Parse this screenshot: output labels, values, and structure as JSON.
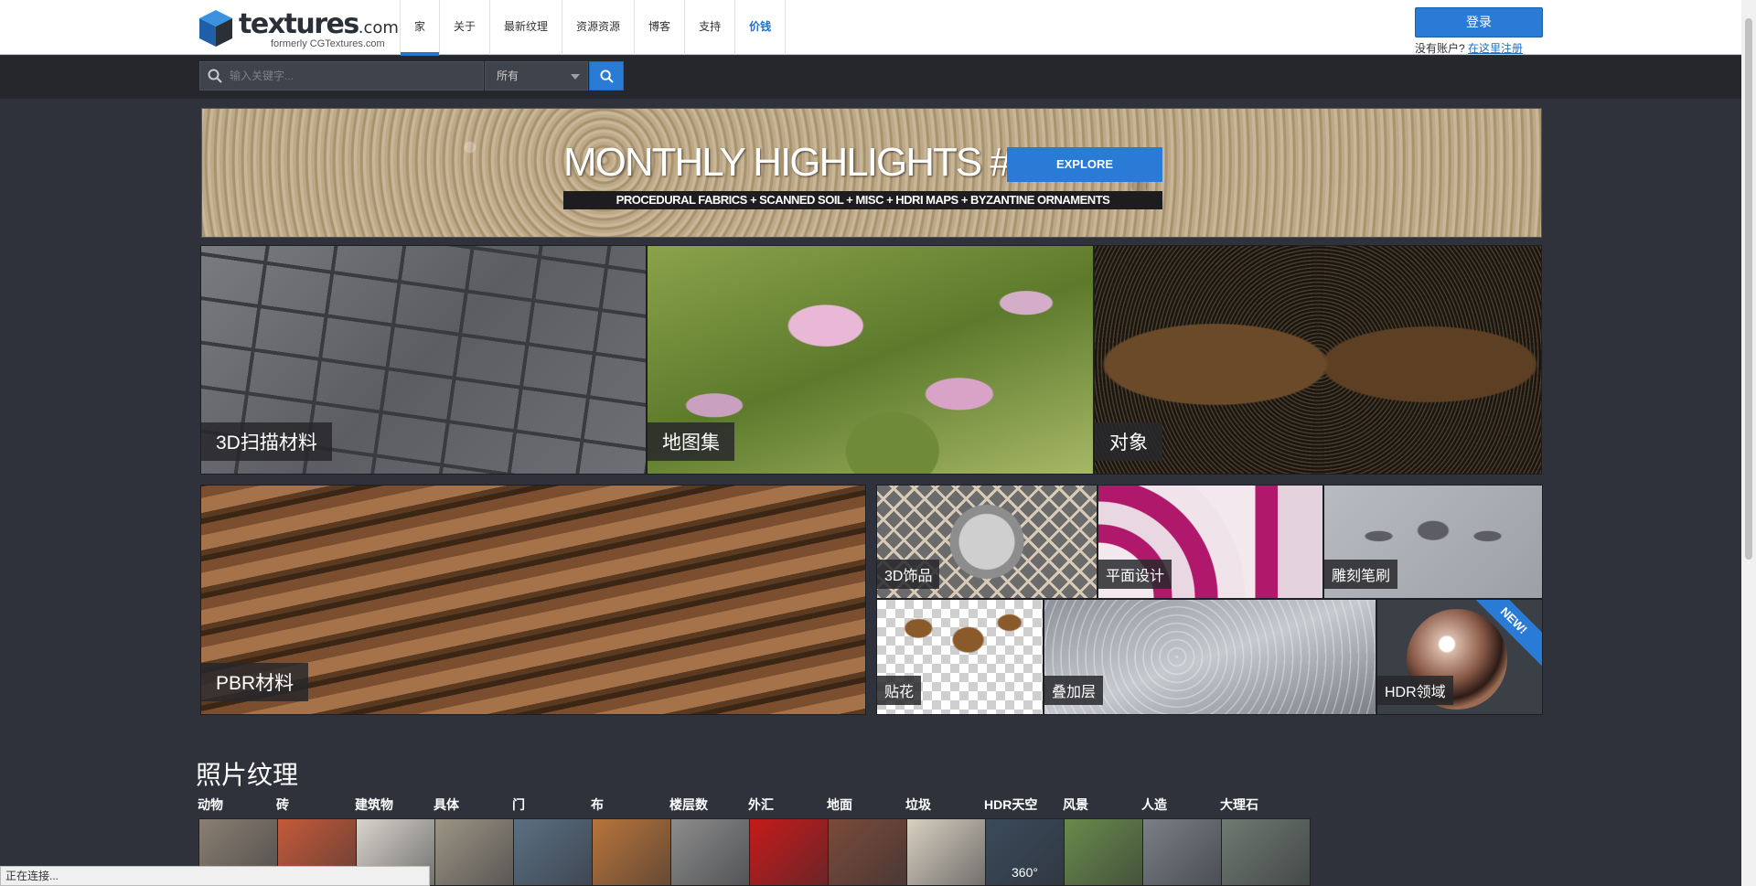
{
  "header": {
    "logo_text": "textures",
    "logo_suffix": ".com",
    "logo_sub": "formerly CGTextures.com",
    "nav": [
      {
        "label": "家",
        "active": true
      },
      {
        "label": "关于"
      },
      {
        "label": "最新纹理"
      },
      {
        "label": "资源资源"
      },
      {
        "label": "博客"
      },
      {
        "label": "支持"
      },
      {
        "label": "价钱",
        "highlight": true
      }
    ],
    "login_label": "登录",
    "no_account": "没有账户?",
    "register_link": "在这里注册"
  },
  "search": {
    "placeholder": "输入关键字...",
    "filter_value": "所有"
  },
  "banner": {
    "title": "MONTHLY HIGHLIGHTS #19",
    "explore": "EXPLORE",
    "subtitle": "PROCEDURAL FABRICS + SCANNED SOIL + MISC + HDRI MAPS + BYZANTINE ORNAMENTS"
  },
  "tiles": {
    "scan": "3D扫描材料",
    "atlas": "地图集",
    "objects": "对象",
    "pbr": "PBR材料",
    "ornaments": "3D饰品",
    "graphic": "平面设计",
    "brush": "雕刻笔刷",
    "decals": "贴花",
    "overlays": "叠加层",
    "hdr": "HDR领域",
    "new_badge": "NEW!"
  },
  "photo_section": {
    "title": "照片纹理",
    "categories": [
      {
        "name": "动物",
        "color": "#8a7f72"
      },
      {
        "name": "砖",
        "color": "#c45a3a"
      },
      {
        "name": "建筑物",
        "color": "#d8d4cc"
      },
      {
        "name": "具体",
        "color": "#9c9484"
      },
      {
        "name": "门",
        "color": "#5b6f82"
      },
      {
        "name": "布",
        "color": "#b8743a"
      },
      {
        "name": "楼层数",
        "color": "#8c8c8c"
      },
      {
        "name": "外汇",
        "color": "#c61a1a"
      },
      {
        "name": "地面",
        "color": "#7a4a3a"
      },
      {
        "name": "垃圾",
        "color": "#d8d0c0"
      },
      {
        "name": "HDR天空",
        "color": "#3a4a5a"
      },
      {
        "name": "风景",
        "color": "#6a8a4a"
      },
      {
        "name": "人造",
        "color": "#7a7f86"
      },
      {
        "name": "大理石",
        "color": "#6f7a72"
      }
    ],
    "hdr_thumb_text": "360°"
  },
  "status": "正在连接..."
}
